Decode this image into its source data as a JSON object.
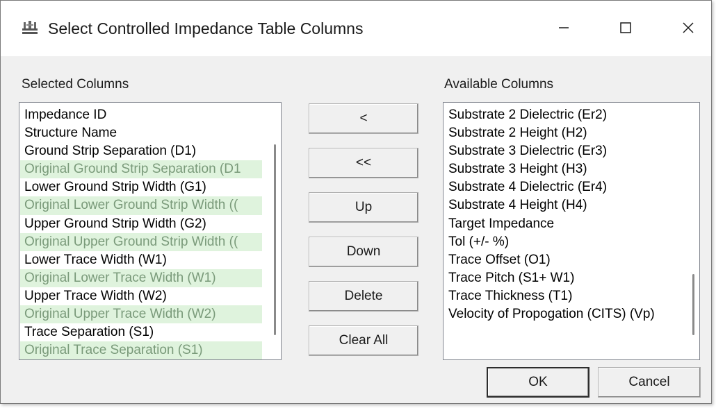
{
  "window": {
    "title": "Select Controlled Impedance Table Columns"
  },
  "icons": {
    "app": "table-columns-icon",
    "minimize": "minimize-icon",
    "maximize": "maximize-icon",
    "close": "close-icon"
  },
  "selected": {
    "label": "Selected Columns",
    "items": [
      {
        "text": "Impedance ID",
        "muted": false
      },
      {
        "text": "Structure Name",
        "muted": false
      },
      {
        "text": "Ground Strip Separation (D1)",
        "muted": false
      },
      {
        "text": "Original Ground Strip Separation (D1",
        "muted": true
      },
      {
        "text": "Lower Ground Strip Width (G1)",
        "muted": false
      },
      {
        "text": "Original Lower Ground Strip Width ((",
        "muted": true
      },
      {
        "text": "Upper Ground Strip Width (G2)",
        "muted": false
      },
      {
        "text": "Original Upper Ground Strip Width ((",
        "muted": true
      },
      {
        "text": "Lower Trace Width (W1)",
        "muted": false
      },
      {
        "text": "Original Lower Trace Width (W1)",
        "muted": true
      },
      {
        "text": "Upper Trace Width (W2)",
        "muted": false
      },
      {
        "text": "Original Upper Trace Width (W2)",
        "muted": true
      },
      {
        "text": "Trace Separation (S1)",
        "muted": false
      },
      {
        "text": "Original Trace Separation (S1)",
        "muted": true
      }
    ]
  },
  "buttons": {
    "remove_one": "<",
    "remove_all": "<<",
    "up": "Up",
    "down": "Down",
    "delete": "Delete",
    "clear_all": "Clear All",
    "ok": "OK",
    "cancel": "Cancel"
  },
  "available": {
    "label": "Available Columns",
    "items": [
      "Substrate 2 Dielectric (Er2)",
      "Substrate 2 Height (H2)",
      "Substrate 3 Dielectric (Er3)",
      "Substrate 3 Height (H3)",
      "Substrate 4 Dielectric (Er4)",
      "Substrate 4 Height (H4)",
      "Target Impedance",
      "Tol (+/- %)",
      "Trace Offset (O1)",
      "Trace Pitch (S1+ W1)",
      "Trace Thickness (T1)",
      "Velocity of Propogation (CITS) (Vp)"
    ]
  },
  "colors": {
    "shaded_row": "#dff3dd",
    "muted_text": "#7a9a7a"
  }
}
